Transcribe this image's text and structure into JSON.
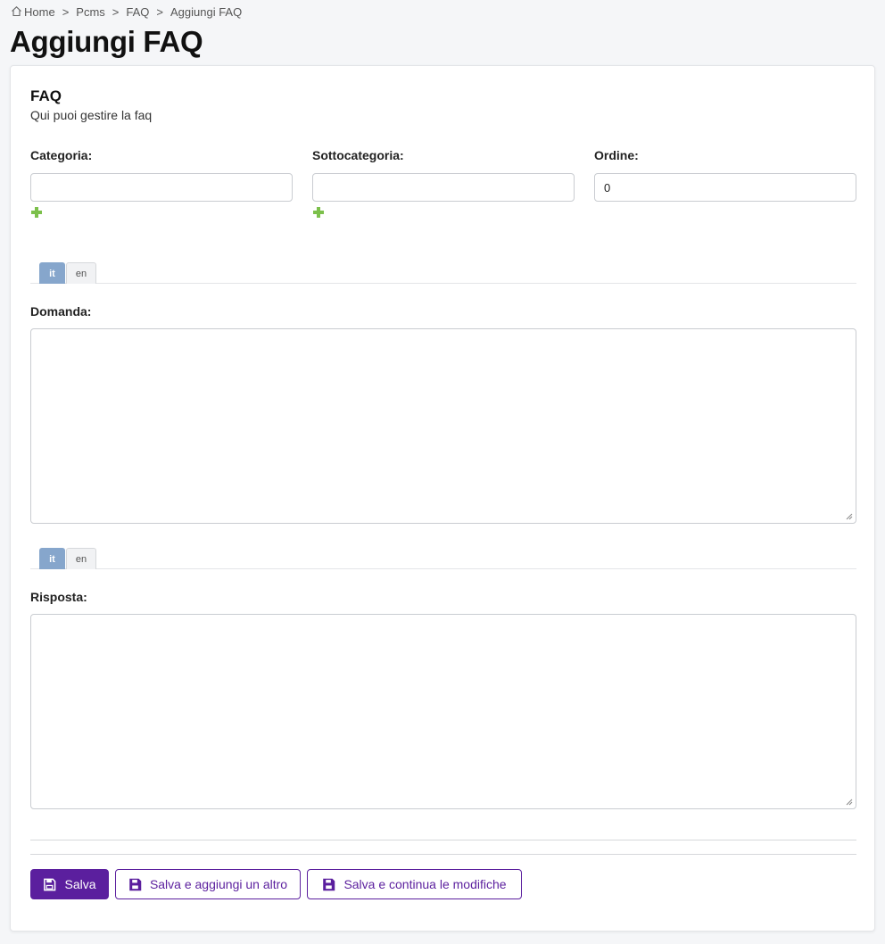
{
  "breadcrumb": {
    "items": [
      "Home",
      "Pcms",
      "FAQ",
      "Aggiungi FAQ"
    ],
    "separator": ">"
  },
  "page": {
    "title": "Aggiungi FAQ"
  },
  "section": {
    "title": "FAQ",
    "subtitle": "Qui puoi gestire la faq"
  },
  "fields": {
    "categoria": {
      "label": "Categoria:",
      "value": ""
    },
    "sottocategoria": {
      "label": "Sottocategoria:",
      "value": ""
    },
    "ordine": {
      "label": "Ordine:",
      "value": "0"
    }
  },
  "language_tabs": {
    "active": "it",
    "inactive": "en"
  },
  "domanda": {
    "label": "Domanda:",
    "value": ""
  },
  "risposta": {
    "label": "Risposta:",
    "value": ""
  },
  "buttons": {
    "save": "Salva",
    "save_add_another": "Salva e aggiungi un altro",
    "save_continue": "Salva e continua le modifiche"
  },
  "colors": {
    "primary": "#5b1f9e",
    "tab_active": "#86a6cc",
    "add_icon": "#7cc04b"
  },
  "icons": {
    "breadcrumb_home": "home-icon",
    "add": "plus-icon",
    "save": "floppy-disk-icon"
  }
}
